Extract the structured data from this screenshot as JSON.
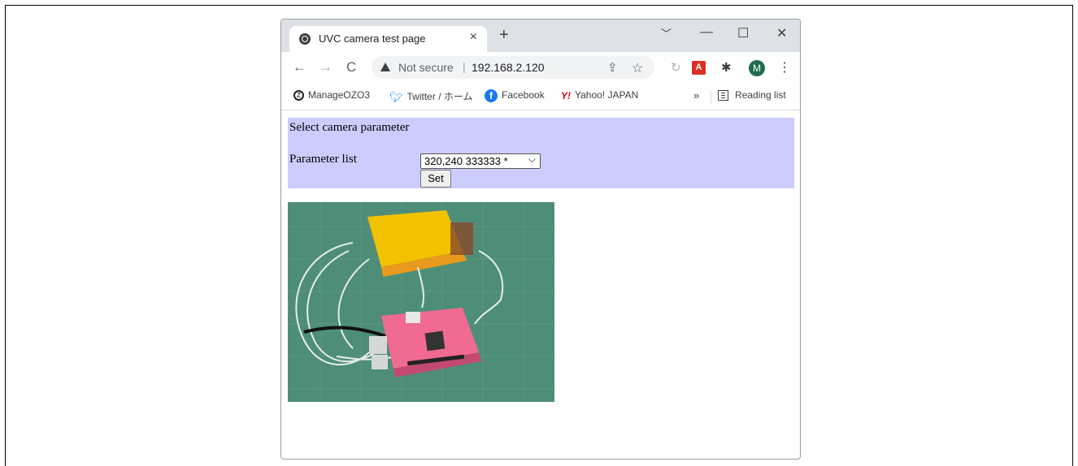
{
  "tab": {
    "title": "UVC camera test page",
    "close": "×",
    "new_tab": "+"
  },
  "window_controls": {
    "dropdown": "﹀",
    "minimize": "—",
    "maximize": "☐",
    "close": "✕"
  },
  "toolbar": {
    "back": "←",
    "forward": "→",
    "reload": "C",
    "security_label": "Not secure",
    "separator": "|",
    "url": "192.168.2.120",
    "profile_initial": "M"
  },
  "bookmarks": {
    "items": [
      {
        "label": "ManageOZO3"
      },
      {
        "label": "Twitter / ホーム"
      },
      {
        "label": "Facebook"
      },
      {
        "label": "Yahoo! JAPAN"
      }
    ],
    "overflow": "»",
    "reading_list": "Reading list"
  },
  "page": {
    "panel_title": "Select camera parameter",
    "param_label": "Parameter list",
    "param_value": "320,240 333333 *",
    "set_label": "Set"
  }
}
